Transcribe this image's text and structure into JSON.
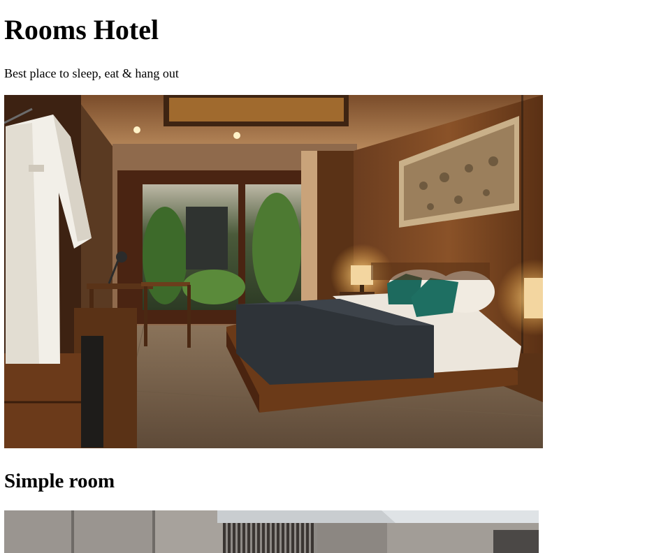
{
  "page": {
    "title": "Rooms Hotel",
    "tagline": "Best place to sleep, eat & hang out"
  },
  "rooms": [
    {
      "heading": "",
      "image_alt": "Hotel bedroom with wooden bed, dark grey blanket, teal pillows, bathrobe on hanger, window to tropical garden"
    },
    {
      "heading": "Simple room",
      "image_alt": "Bright modern room interior with slatted wood panel"
    }
  ],
  "colors": {
    "background": "#ffffff",
    "text": "#000000"
  }
}
